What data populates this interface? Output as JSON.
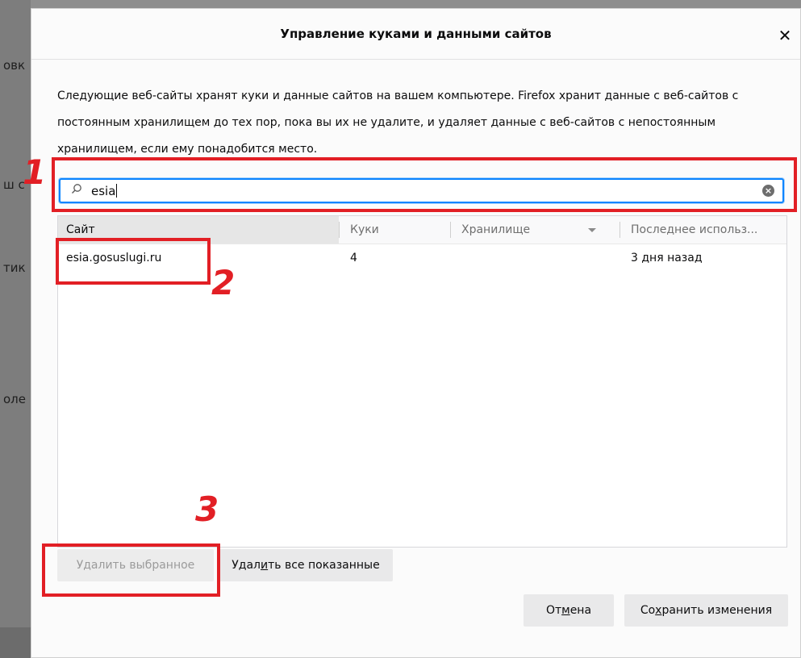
{
  "background": {
    "fragments": [
      "овк",
      "ш с",
      "тик",
      "оле"
    ]
  },
  "dialog": {
    "title": "Управление куками и данными сайтов",
    "close_icon": "close-icon",
    "description": "Следующие веб-сайты хранят куки и данные сайтов на вашем компьютере. Firefox хранит данные с веб-сайтов с постоянным хранилищем до тех пор, пока вы их не удалите, и удаляет данные с веб-сайтов с непостоянным хранилищем, если ему понадобится место.",
    "search": {
      "value": "esia",
      "icon": "search-icon",
      "clear_icon": "clear-icon"
    },
    "table": {
      "columns": [
        "Сайт",
        "Куки",
        "Хранилище",
        "Последнее использ..."
      ],
      "rows": [
        {
          "site": "esia.gosuslugi.ru",
          "cookies": "4",
          "storage": "",
          "last_used": "3 дня назад"
        }
      ]
    },
    "buttons": {
      "remove_selected_pre": "У",
      "remove_selected_u": "д",
      "remove_selected_post": "алить выбранное",
      "remove_all_pre": "Удал",
      "remove_all_u": "и",
      "remove_all_post": "ть все показанные",
      "cancel_pre": "От",
      "cancel_u": "м",
      "cancel_post": "ена",
      "save_pre": "Со",
      "save_u": "х",
      "save_post": "ранить изменения"
    }
  },
  "annotations": {
    "labels": [
      "1",
      "2",
      "3"
    ],
    "color": "#e21f25"
  },
  "colors": {
    "accent": "#0a84ff"
  }
}
